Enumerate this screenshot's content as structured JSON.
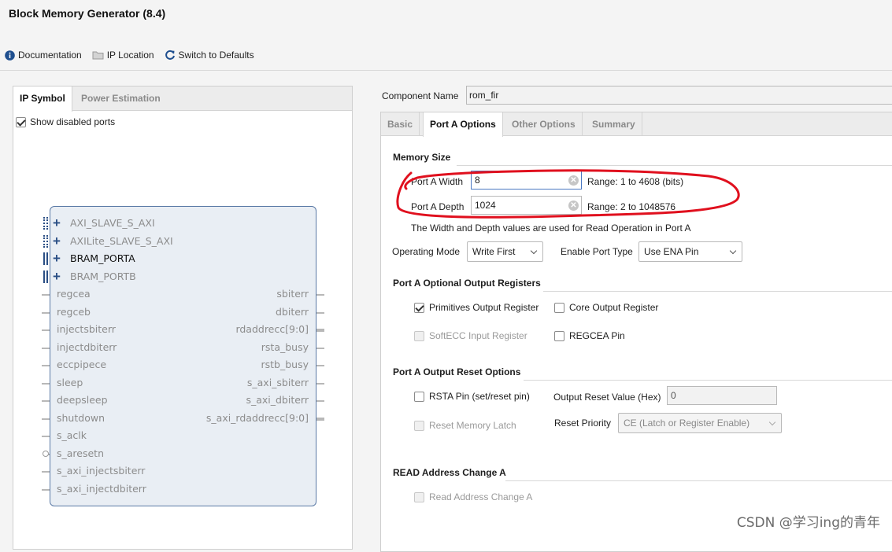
{
  "window": {
    "title": "Block Memory Generator (8.4)"
  },
  "toolbar": {
    "documentation": "Documentation",
    "ip_location": "IP Location",
    "switch_defaults": "Switch to Defaults"
  },
  "left_panel": {
    "tabs": [
      "IP Symbol",
      "Power Estimation"
    ],
    "show_disabled_ports": "Show disabled ports",
    "buses": [
      "AXI_SLAVE_S_AXI",
      "AXILite_SLAVE_S_AXI",
      "BRAM_PORTA",
      "BRAM_PORTB"
    ],
    "left_ports": [
      "regcea",
      "regceb",
      "injectsbiterr",
      "injectdbiterr",
      "eccpipece",
      "sleep",
      "deepsleep",
      "shutdown",
      "s_aclk",
      "s_aresetn",
      "s_axi_injectsbiterr",
      "s_axi_injectdbiterr"
    ],
    "right_ports": [
      "sbiterr",
      "dbiterr",
      "rdaddrecc[9:0]",
      "rsta_busy",
      "rstb_busy",
      "s_axi_sbiterr",
      "s_axi_dbiterr",
      "s_axi_rdaddrecc[9:0]"
    ]
  },
  "component": {
    "label": "Component Name",
    "value": "rom_fir"
  },
  "tabs": [
    "Basic",
    "Port A Options",
    "Other Options",
    "Summary"
  ],
  "memory_size": {
    "title": "Memory Size",
    "width_label": "Port A Width",
    "width_value": "8",
    "width_range": "Range: 1 to 4608 (bits)",
    "depth_label": "Port A Depth",
    "depth_value": "1024",
    "depth_range": "Range: 2 to 1048576",
    "note": "The Width and Depth values are used for Read Operation in Port A",
    "operating_mode_label": "Operating Mode",
    "operating_mode_value": "Write First",
    "enable_port_label": "Enable Port Type",
    "enable_port_value": "Use ENA Pin"
  },
  "output_registers": {
    "title": "Port A Optional Output Registers",
    "primitives": "Primitives Output Register",
    "core": "Core Output Register",
    "softecc": "SoftECC Input Register",
    "regcea": "REGCEA Pin"
  },
  "reset_options": {
    "title": "Port A Output Reset Options",
    "rsta": "RSTA Pin (set/reset pin)",
    "reset_value_label": "Output Reset Value (Hex)",
    "reset_value": "0",
    "reset_latch": "Reset Memory Latch",
    "priority_label": "Reset Priority",
    "priority_value": "CE (Latch or Register Enable)"
  },
  "read_address": {
    "title": "READ Address Change A",
    "option": "Read Address Change A"
  },
  "watermark": "CSDN @学习ing的青年",
  "colors": {
    "annotation": "#e0101e",
    "accent": "#4a78c2",
    "block_border": "#5b7aa6"
  }
}
